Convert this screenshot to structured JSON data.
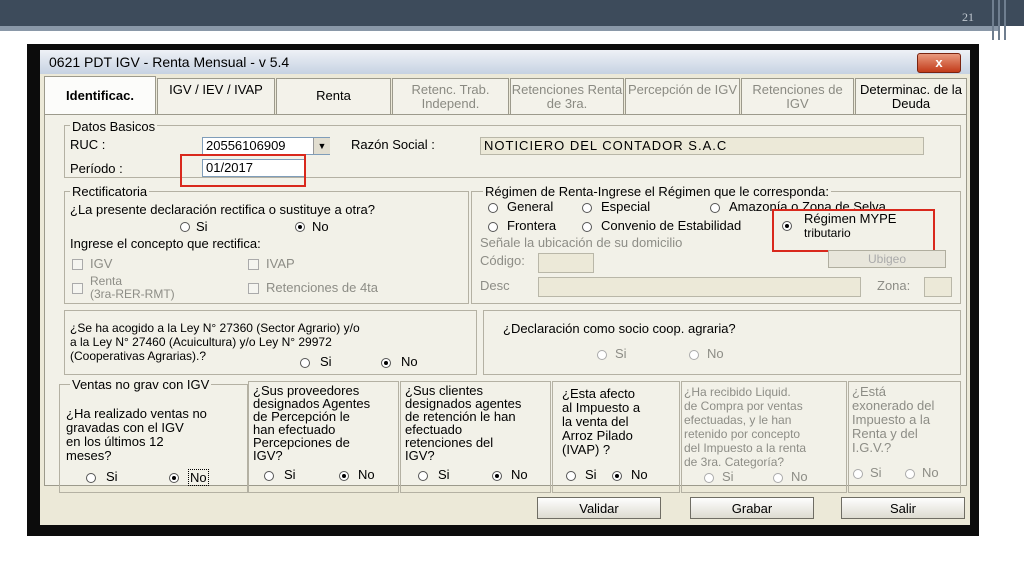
{
  "slide": {
    "number": "21"
  },
  "window": {
    "title": "0621 PDT IGV - Renta Mensual - v 5.4",
    "close_label": "x"
  },
  "tabs": [
    {
      "label": "Identificac."
    },
    {
      "label": "IGV / IEV / IVAP"
    },
    {
      "label": "Renta"
    },
    {
      "label": "Retenc. Trab. Independ."
    },
    {
      "label": "Retenciones Renta de 3ra."
    },
    {
      "label": "Percepción de IGV"
    },
    {
      "label": "Retenciones de IGV"
    },
    {
      "label": "Determinac. de la Deuda"
    }
  ],
  "datos_basicos": {
    "legend": "Datos Basicos",
    "ruc_label": "RUC :",
    "ruc_value": "20556106909",
    "razon_label": "Razón Social :",
    "razon_value": "NOTICIERO DEL CONTADOR S.A.C",
    "periodo_label": "Período :",
    "periodo_value": "01/2017"
  },
  "rectificatoria": {
    "legend": "Rectificatoria",
    "question": "¿La presente declaración rectifica o sustituye a otra?",
    "si": "Si",
    "no": "No",
    "concepto_label": "Ingrese el concepto que rectifica:",
    "igv": "IGV",
    "ivap": "IVAP",
    "renta_line1": "Renta",
    "renta_line2": "(3ra-RER-RMT)",
    "ret4ta": "Retenciones de 4ta"
  },
  "regimen": {
    "legend": "Régimen de Renta-Ingrese el Régimen que le corresponda:",
    "general": "General",
    "especial": "Especial",
    "amazonia": "Amazonía o Zona de Selva",
    "frontera": "Frontera",
    "convenio": "Convenio de Estabilidad",
    "mype_line1": "Régimen MYPE",
    "mype_line2": "tributario",
    "ubicacion": "Señale la ubicación de su domicilio",
    "codigo": "Código:",
    "ubigeo": "Ubigeo",
    "desc": "Desc",
    "zona": "Zona:"
  },
  "ley": {
    "line1": "¿Se ha acogido a la Ley N° 27360 (Sector Agrario) y/o",
    "line2": "a la Ley N° 27460 (Acuicultura) y/o Ley N° 29972",
    "line3": "(Cooperativas Agrarias).?",
    "si": "Si",
    "no": "No"
  },
  "socio": {
    "question": "¿Declaración como socio coop. agraria?",
    "si": "Si",
    "no": "No"
  },
  "ventas": {
    "legend": "Ventas no grav con IGV",
    "line1": "¿Ha realizado ventas no",
    "line2": "gravadas   con el IGV",
    "line3": "en los últimos 12",
    "line4": "meses?",
    "si": "Si",
    "no": "No"
  },
  "proveedores": {
    "line1": "¿Sus proveedores",
    "line2": "designados Agentes",
    "line3": "de Percepción le",
    "line4": "han efectuado",
    "line5": "Percepciones de",
    "line6": "IGV?",
    "si": "Si",
    "no": "No"
  },
  "clientes": {
    "line1": "¿Sus clientes",
    "line2": "designados agentes",
    "line3": "de retención le han",
    "line4": "efectuado",
    "line5": "retenciones del",
    "line6": "IGV?",
    "si": "Si",
    "no": "No"
  },
  "arroz": {
    "line1": "¿Esta   afecto",
    "line2": "al Impuesto  a",
    "line3": "la venta  del",
    "line4": "Arroz Pilado",
    "line5": "(IVAP) ?",
    "si": "Si",
    "no": "No"
  },
  "liquid": {
    "line1": "¿Ha recibido Liquid.",
    "line2": "de Compra por ventas",
    "line3": "efectuadas, y le han",
    "line4": "retenido por concepto",
    "line5": "del Impuesto a la renta",
    "line6": "de 3ra. Categoría?",
    "si": "Si",
    "no": "No"
  },
  "exonerado": {
    "line1": "¿Está",
    "line2": "exonerado del",
    "line3": "Impuesto a la",
    "line4": "Renta y del",
    "line5": "I.G.V.?",
    "si": "Si",
    "no": "No"
  },
  "footer": {
    "validar": "Validar",
    "grabar": "Grabar",
    "salir": "Salir"
  }
}
